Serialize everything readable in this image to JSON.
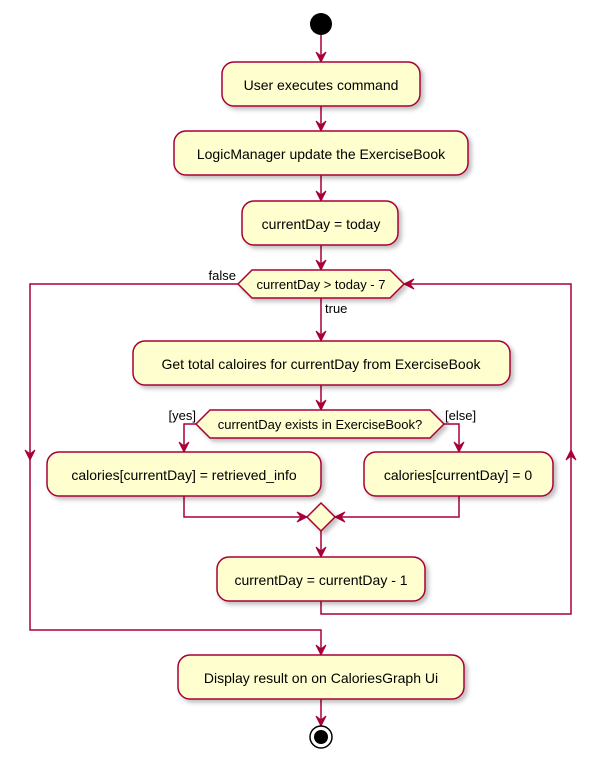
{
  "colors": {
    "fill": "#FEFECE",
    "stroke": "#A80036"
  },
  "activities": {
    "a1": "User executes command",
    "a2": "LogicManager update the ExerciseBook",
    "a3": "currentDay = today",
    "a4": "Get total caloires for currentDay from ExerciseBook",
    "a5": "calories[currentDay] = retrieved_info",
    "a6": "calories[currentDay] = 0",
    "a7": "currentDay = currentDay - 1",
    "a8": "Display result on on CaloriesGraph Ui"
  },
  "conditions": {
    "loop": "currentDay > today - 7",
    "loop_true": "true",
    "loop_false": "false",
    "ifc": "currentDay exists in ExerciseBook?",
    "if_yes": "[yes]",
    "if_else": "[else]"
  }
}
